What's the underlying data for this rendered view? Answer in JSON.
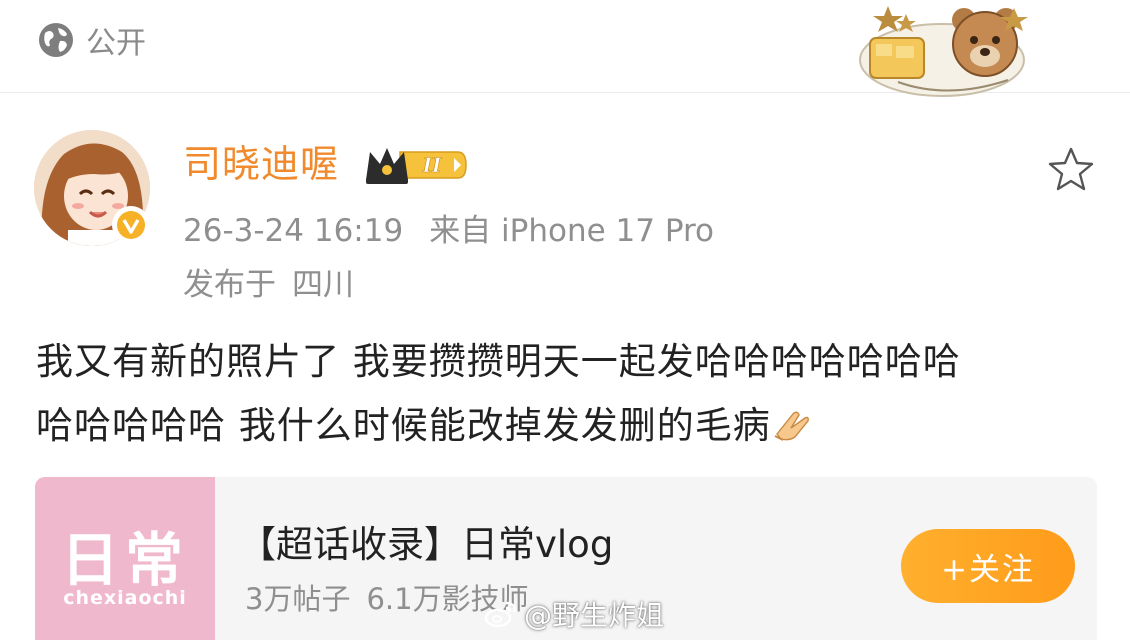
{
  "header": {
    "visibility_label": "公开",
    "visibility_icon": "globe-icon",
    "sticker_icon": "bear-sticker"
  },
  "post": {
    "author": "司晓迪喔",
    "member_level": "II",
    "verified": true,
    "timestamp": "26-3-24 16:19",
    "source": "来自 iPhone 17 Pro",
    "location_prefix": "发布于",
    "location": "四川",
    "text_line1": "我又有新的照片了 我要攒攒明天一起发哈哈哈哈哈哈哈",
    "text_line2": "哈哈哈哈哈 我什么时候能改掉发发删的毛病",
    "trailing_emoji": "pray-icon"
  },
  "topic_card": {
    "cover_title": "日常",
    "cover_subtitle": "chexiaochi",
    "title": "【超话收录】日常vlog",
    "posts": "3万帖子",
    "followers": "6.1万影技师",
    "follow_label": "+关注"
  },
  "watermark": {
    "text": "@野生炸姐"
  },
  "colors": {
    "accent": "#f08a2c",
    "follow_button": "#ffa526",
    "muted_text": "#8f8f8f",
    "card_bg": "#f5f5f5",
    "cover_bg": "#f0b8cc"
  }
}
